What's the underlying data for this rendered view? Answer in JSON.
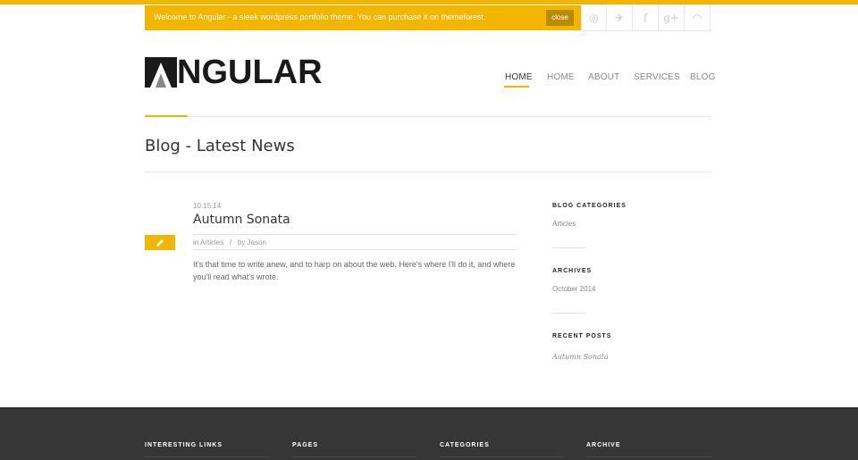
{
  "notice": {
    "text": "Welcome to Angular - a sleek wordpress portfolio theme. You can purchase it on themeforest.",
    "close_label": "close"
  },
  "social": [
    {
      "icon": "dribbble-icon",
      "glyph": "◎"
    },
    {
      "icon": "twitter-icon",
      "glyph": "✈"
    },
    {
      "icon": "facebook-icon",
      "glyph": "f"
    },
    {
      "icon": "google-plus-icon",
      "glyph": "g+"
    },
    {
      "icon": "rss-icon",
      "glyph": "◠"
    }
  ],
  "logo": {
    "text": "NGULAR"
  },
  "nav": {
    "items": [
      {
        "label": "HOME",
        "active": true
      },
      {
        "label": "HOME",
        "active": false
      },
      {
        "label": "ABOUT",
        "active": false
      },
      {
        "label": "SERVICES",
        "active": false
      },
      {
        "label": "BLOG",
        "active": false
      }
    ]
  },
  "page": {
    "title": "Blog - Latest News"
  },
  "post": {
    "date": "10.15.14",
    "title": "Autumn Sonata",
    "meta_in": "in",
    "category": "Articles",
    "sep": "/",
    "meta_by": "by",
    "author": "Jason",
    "excerpt": "It's that time to write anew, and to harp on about the web. Here's where I'll do it, and where you'll read what's wrote."
  },
  "sidebar": {
    "categories_title": "BLOG CATEGORIES",
    "categories_item": "Articles",
    "archives_title": "ARCHIVES",
    "archives_item": "October 2014",
    "recent_title": "RECENT POSTS",
    "recent_item": "Autumn Sonata"
  },
  "footer": {
    "col1": "INTERESTING LINKS",
    "col2": "PAGES",
    "col3": "CATEGORIES",
    "col4": "ARCHIVE"
  },
  "colors": {
    "accent": "#f2b500",
    "footer": "#363636"
  }
}
